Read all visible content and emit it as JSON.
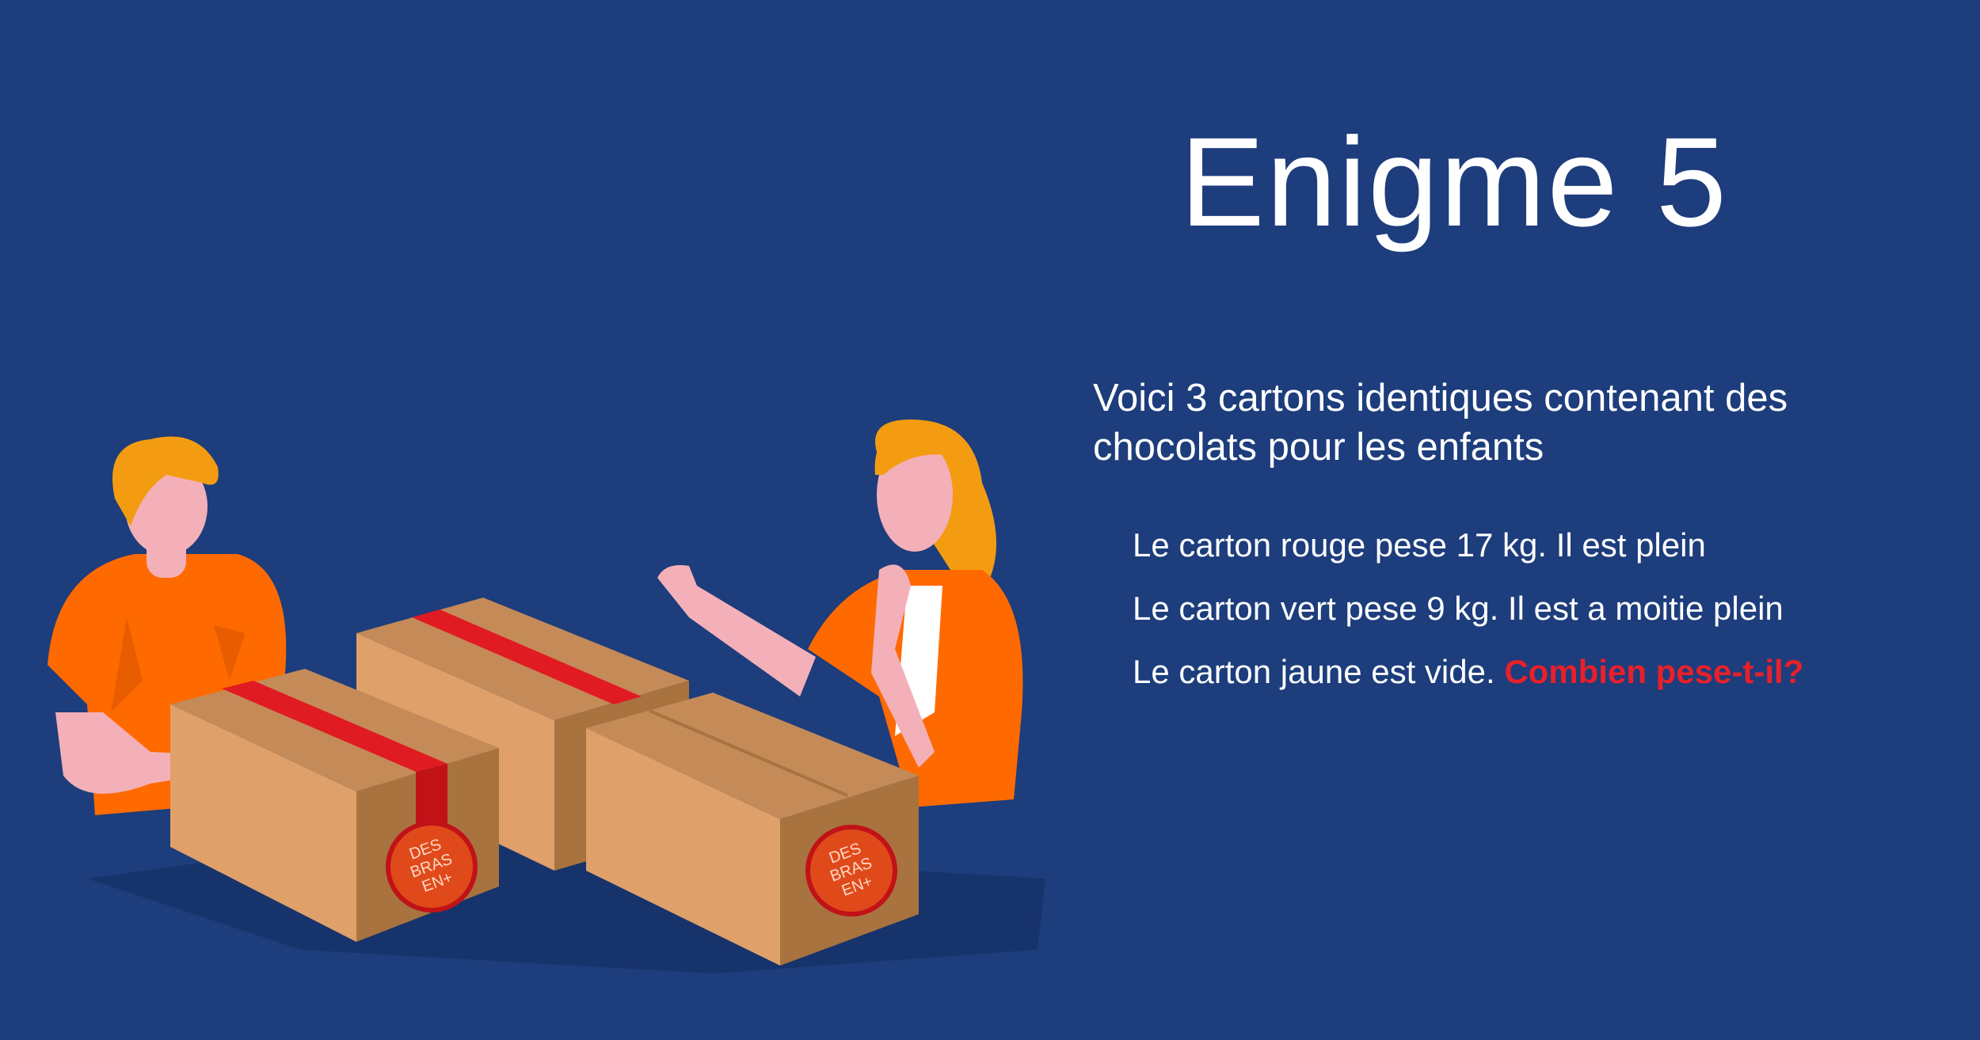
{
  "title": "Enigme 5",
  "intro": "Voici 3 cartons identiques contenant des chocolats pour les enfants",
  "clues": [
    "Le carton rouge pese 17 kg. Il est plein",
    "Le carton vert pese 9 kg. Il est a moitie plein",
    "Le carton jaune est vide."
  ],
  "question": "Combien pese-t-il?",
  "logo_text": [
    "DES",
    "BRAS",
    "EN+"
  ],
  "colors": {
    "background": "#1d3d7c",
    "shirt": "#ff6a00",
    "hair": "#f39c12",
    "skin": "#f4b0b8",
    "box": "#dfa06a",
    "tape": "#e01b22",
    "question": "#e8202a"
  }
}
